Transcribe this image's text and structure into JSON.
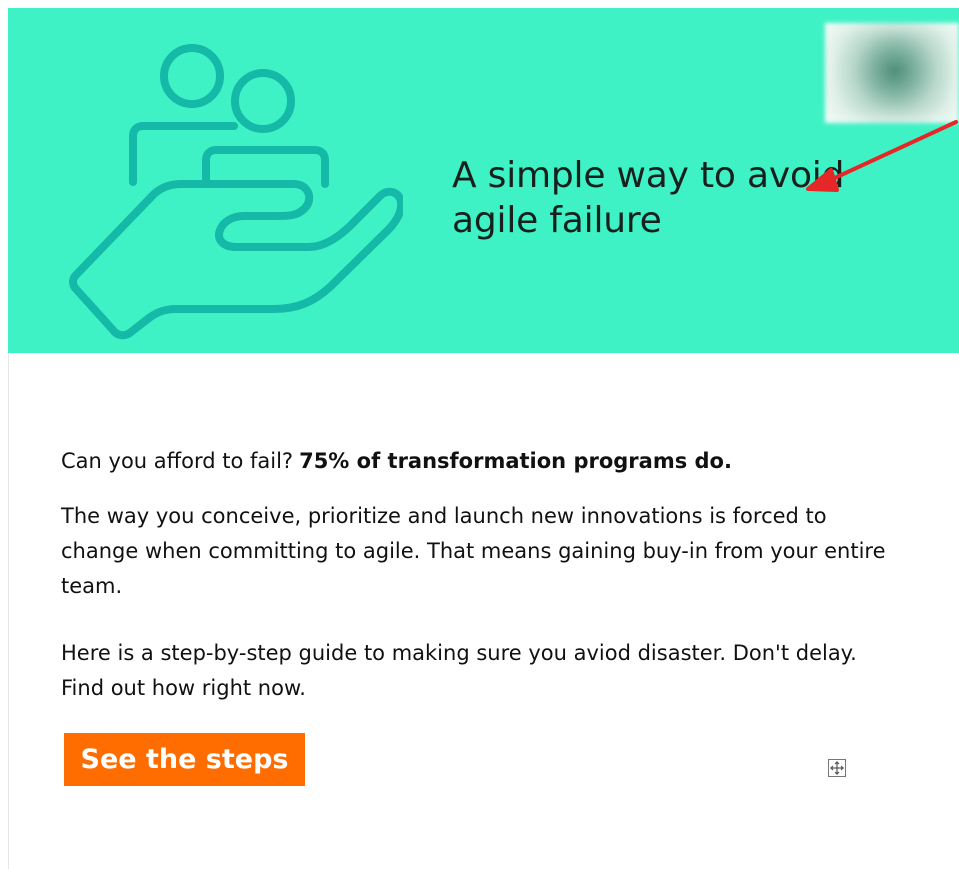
{
  "hero": {
    "title": "A simple way to avoid agile failure",
    "background_color": "#3ff2c6",
    "illustration_icon": "people-on-hand-icon",
    "thumbnail": "blurred-image-thumbnail",
    "annotation_icon": "red-arrow-icon"
  },
  "content": {
    "intro_question": "Can you afford to fail?",
    "intro_stat": "75% of transformation programs do.",
    "paragraph_one": "The way you conceive, prioritize and launch new innovations is forced to change when committing to agile. That means gaining buy-in from your entire team.",
    "paragraph_two": "Here is a step-by-step guide to making sure you aviod disaster. Don't delay. Find out how right now."
  },
  "cta": {
    "label": "See the steps",
    "background_color": "#ff6d00",
    "text_color": "#ffffff"
  },
  "controls": {
    "handle_icon": "move-handle-icon"
  }
}
